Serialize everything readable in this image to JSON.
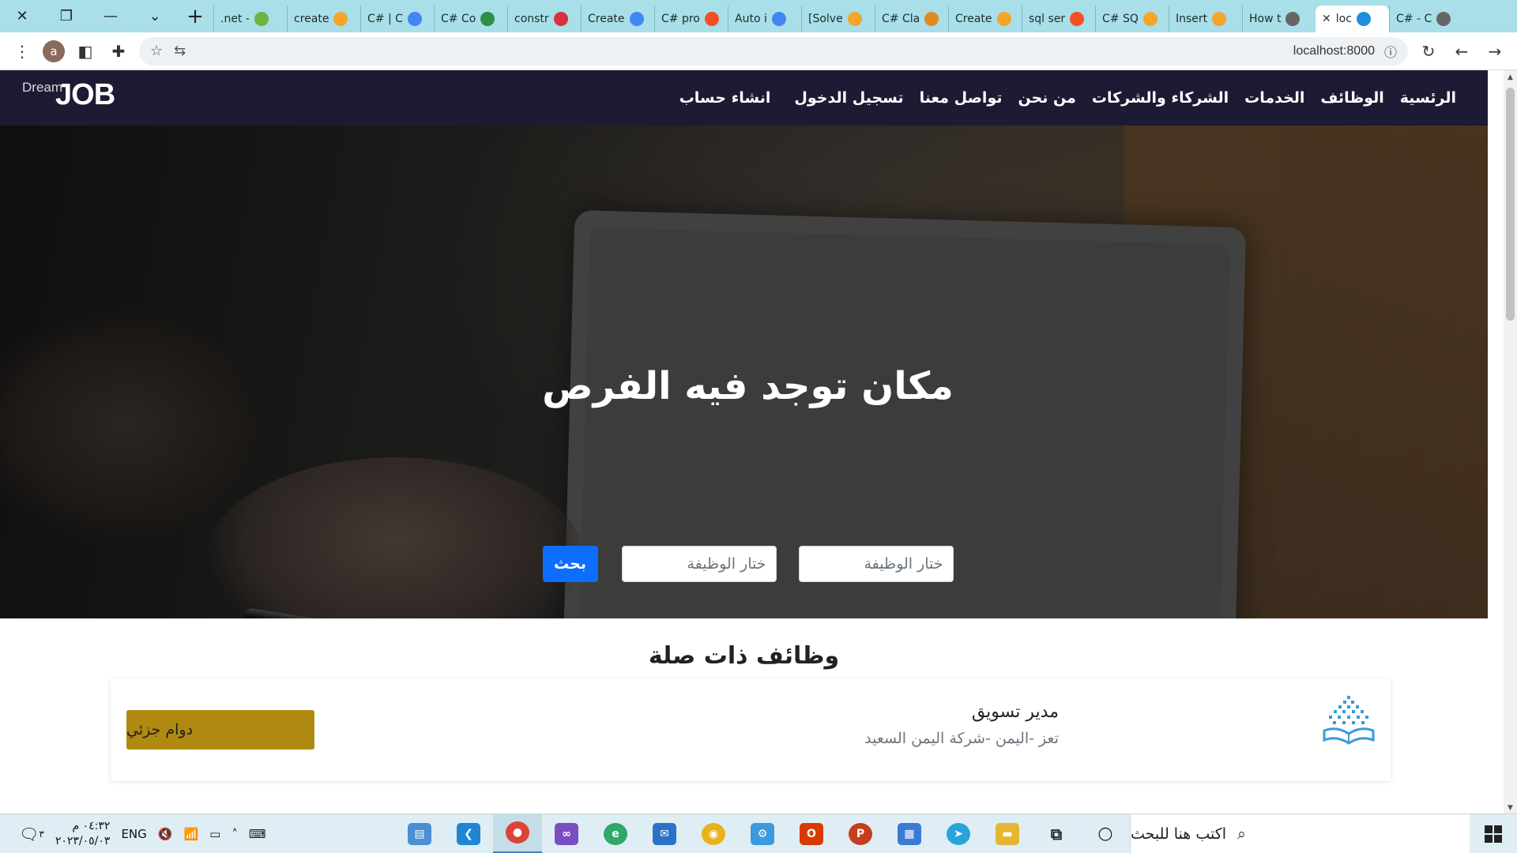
{
  "browser": {
    "tabs": [
      {
        "label": ".net - ",
        "fav": "#6db33f"
      },
      {
        "label": "create",
        "fav": "#f4a52a"
      },
      {
        "label": "C# | C",
        "fav": "#4285f4"
      },
      {
        "label": "C# Co",
        "fav": "#2f8d46"
      },
      {
        "label": "constr",
        "fav": "#d9303e"
      },
      {
        "label": "Create",
        "fav": "#4285f4"
      },
      {
        "label": "C# pro",
        "fav": "#f25022"
      },
      {
        "label": "Auto i",
        "fav": "#4285f4"
      },
      {
        "label": "[Solve",
        "fav": "#f4a52a"
      },
      {
        "label": "C# Cla",
        "fav": "#e08a1e"
      },
      {
        "label": "Create",
        "fav": "#f4a52a"
      },
      {
        "label": "sql ser",
        "fav": "#f25022"
      },
      {
        "label": "C# SQ",
        "fav": "#f4a52a"
      },
      {
        "label": "Insert",
        "fav": "#f4a52a"
      },
      {
        "label": "How t",
        "fav": "#666666"
      },
      {
        "label": "loc",
        "fav": "#1f8fdc",
        "active": true
      },
      {
        "label": "C# - C",
        "fav": "#666666"
      }
    ],
    "url": "localhost:8000",
    "profile_initial": "a"
  },
  "site": {
    "logo_small": "Dream",
    "logo_big": "JOB",
    "nav": [
      "الرئسية",
      "الوظائف",
      "الخدمات",
      "الشركاء والشركات",
      "من نحن",
      "تواصل معنا",
      "تسجيل الدخول",
      "انشاء حساب"
    ],
    "hero_title": "مكان توجد فيه الفرص",
    "search": {
      "select1": "ختار الوظيفة",
      "select2": "ختار الوظيفة",
      "button": "بحث"
    },
    "related_title": "وظائف ذات صلة",
    "job": {
      "title": "مدير تسويق",
      "location": "تعز -اليمن -شركة اليمن السعيد",
      "type": "دوام جزئي"
    }
  },
  "taskbar": {
    "search_placeholder": "اكتب هنا للبحث",
    "time": "٠٤:٣٢ م",
    "date": "٢٠٢٣/٠٥/٠٣",
    "lang": "ENG",
    "notif_count": "٣"
  }
}
